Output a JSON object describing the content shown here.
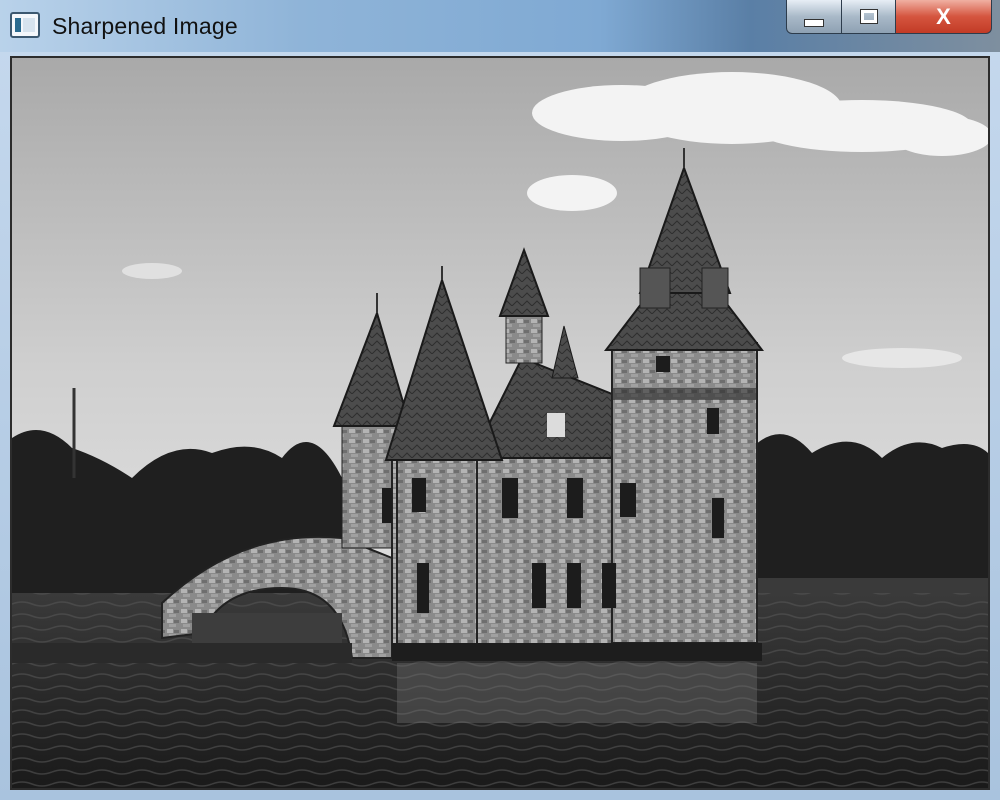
{
  "window": {
    "title": "Sharpened Image",
    "icon": "app-icon",
    "controls": {
      "minimize_icon": "minimize-icon",
      "maximize_icon": "maximize-icon",
      "close_label": "X"
    }
  },
  "content": {
    "image_subject": "stone castle boathouse on water"
  }
}
